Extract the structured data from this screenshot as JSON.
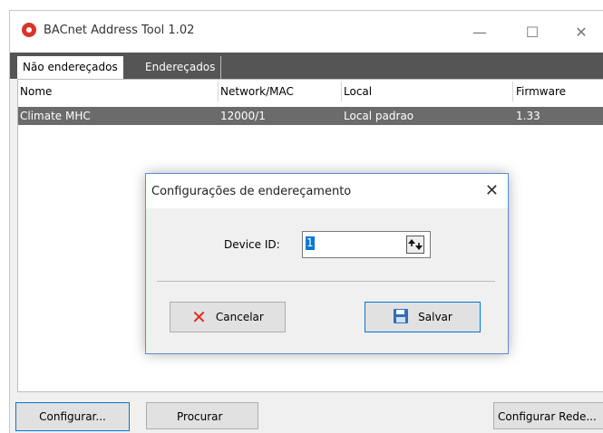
{
  "window": {
    "title": "BACnet Address Tool 1.02",
    "minimize_icon": "minimize-icon",
    "maximize_icon": "maximize-icon",
    "close_icon": "close-icon"
  },
  "tabs": [
    {
      "label": "Não endereçados",
      "active": true
    },
    {
      "label": "Endereçados",
      "active": false
    }
  ],
  "table": {
    "columns": [
      "Nome",
      "Network/MAC",
      "Local",
      "Firmware"
    ],
    "rows": [
      [
        "Climate MHC",
        "12000/1",
        "Local padrao",
        "1.33"
      ]
    ]
  },
  "buttons": {
    "configurar": "Configurar...",
    "procurar": "Procurar",
    "configurar_rede": "Configurar Rede..."
  },
  "dialog": {
    "title": "Configurações de endereçamento",
    "device_id_label": "Device ID:",
    "device_id_value": "1",
    "cancel_label": "Cancelar",
    "save_label": "Salvar"
  },
  "colors": {
    "tabstrip": "#555555",
    "selected_row": "#6b6b6b",
    "accent": "#0078d7",
    "cancel_icon": "#e2291f"
  }
}
